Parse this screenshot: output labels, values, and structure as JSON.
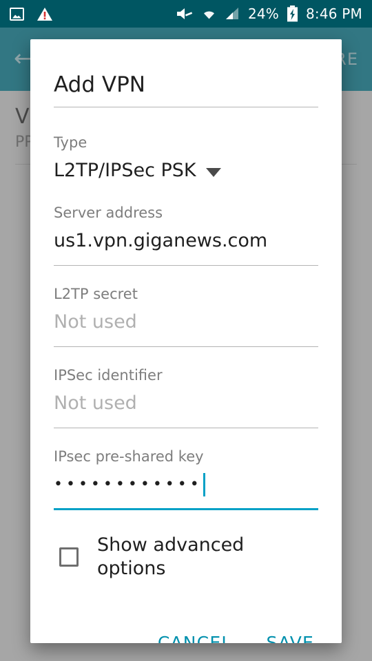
{
  "status_bar": {
    "left_icons": [
      {
        "name": "image-icon",
        "glyph": "image"
      },
      {
        "name": "warning-triangle-icon",
        "glyph": "⚠"
      }
    ],
    "mute_icon": "🔇",
    "wifi_icon": "wifi",
    "signal_icon": "signal",
    "battery_percent": "24%",
    "battery_icon": "charging-battery",
    "clock": "8:46 PM",
    "background": "#005662",
    "foreground": "#ffffff"
  },
  "app_bar": {
    "back_label": "←",
    "overflow_label": "RE",
    "background": "#00778c"
  },
  "background_list": {
    "item_title": "V",
    "item_subtitle": "PP"
  },
  "dialog": {
    "title": "Add VPN",
    "fields": [
      {
        "label": "Type",
        "value": "L2TP/IPSec PSK",
        "is_placeholder": false,
        "has_dropdown": true,
        "focused": false,
        "has_underline": false
      },
      {
        "label": "Server address",
        "value": "us1.vpn.giganews.com",
        "is_placeholder": false,
        "has_dropdown": false,
        "focused": false,
        "has_underline": true
      },
      {
        "label": "L2TP secret",
        "value": "Not used",
        "is_placeholder": true,
        "has_dropdown": false,
        "focused": false,
        "has_underline": true
      },
      {
        "label": "IPSec identifier",
        "value": "Not used",
        "is_placeholder": true,
        "has_dropdown": false,
        "focused": false,
        "has_underline": true
      },
      {
        "label": "IPsec pre-shared key",
        "value": "••••••••••••",
        "is_placeholder": false,
        "has_dropdown": false,
        "focused": true,
        "has_underline": true
      }
    ],
    "checkbox": {
      "label": "Show advanced options",
      "checked": false
    },
    "actions": {
      "cancel_label": "CANCEL",
      "save_label": "SAVE",
      "accent_color": "#0090ad"
    }
  }
}
